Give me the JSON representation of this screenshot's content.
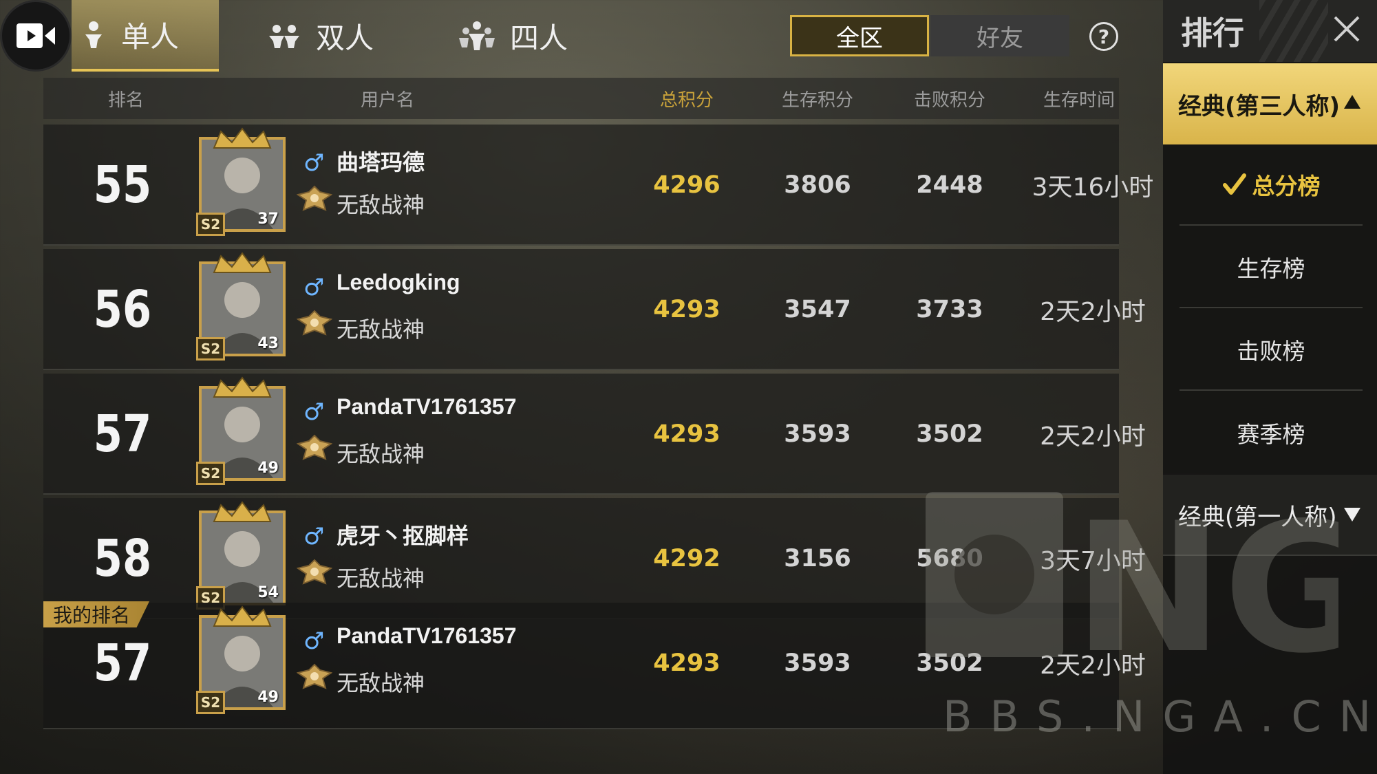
{
  "modes": [
    {
      "label": "单人",
      "active": true
    },
    {
      "label": "双人",
      "active": false
    },
    {
      "label": "四人",
      "active": false
    }
  ],
  "scope": {
    "all": "全区",
    "friends": "好友"
  },
  "help_glyph": "?",
  "columns": {
    "rank": "排名",
    "username": "用户名",
    "total": "总积分",
    "survival": "生存积分",
    "kills": "击败积分",
    "time": "生存时间"
  },
  "rows": [
    {
      "rank": "55",
      "name": "曲塔玛德",
      "title": "无敌战神",
      "level": "37",
      "season": "S2",
      "total": "4296",
      "survival": "3806",
      "kills": "2448",
      "time": "3天16小时"
    },
    {
      "rank": "56",
      "name": "Leedogking",
      "title": "无敌战神",
      "level": "43",
      "season": "S2",
      "total": "4293",
      "survival": "3547",
      "kills": "3733",
      "time": "2天2小时"
    },
    {
      "rank": "57",
      "name": "PandaTV1761357",
      "title": "无敌战神",
      "level": "49",
      "season": "S2",
      "total": "4293",
      "survival": "3593",
      "kills": "3502",
      "time": "2天2小时"
    },
    {
      "rank": "58",
      "name": "虎牙丶抠脚样",
      "title": "无敌战神",
      "level": "54",
      "season": "S2",
      "total": "4292",
      "survival": "3156",
      "kills": "5680",
      "time": "3天7小时"
    }
  ],
  "my_rank": {
    "tag": "我的排名",
    "rank": "57",
    "name": "PandaTV1761357",
    "title": "无敌战神",
    "level": "49",
    "season": "S2",
    "total": "4293",
    "survival": "3593",
    "kills": "3502",
    "time": "2天2小时"
  },
  "gender_symbol": "♂",
  "panel": {
    "title": "排行",
    "open_category": "经典(第三人称)",
    "items": [
      {
        "label": "总分榜",
        "active": true
      },
      {
        "label": "生存榜",
        "active": false
      },
      {
        "label": "击败榜",
        "active": false
      },
      {
        "label": "赛季榜",
        "active": false
      }
    ],
    "closed_category": "经典(第一人称)"
  },
  "watermark": {
    "logo": "NGA",
    "url": "BBS.NGA.CN"
  },
  "colors": {
    "gold": "#e8c340",
    "male": "#6fb6ff",
    "panel_gold": "#f1d67a"
  },
  "icons": [
    "record-icon",
    "solo-person-icon",
    "duo-people-icon",
    "squad-people-icon",
    "help-icon",
    "close-icon",
    "check-icon",
    "triangle-up-icon",
    "triangle-down-icon",
    "crown-icon",
    "title-badge-icon",
    "male-icon"
  ]
}
